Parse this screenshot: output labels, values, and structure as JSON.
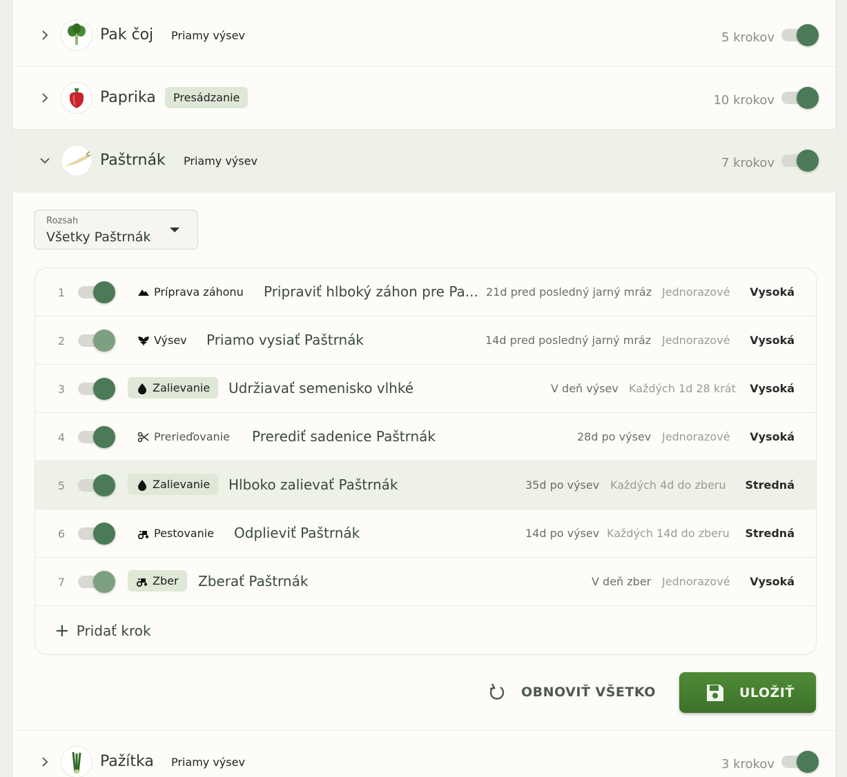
{
  "crops": [
    {
      "name": "Pak čoj",
      "method": "Priamy výsev",
      "steps": "5 krokov",
      "icon": "bok-choy-icon"
    },
    {
      "name": "Paprika",
      "method": "Presádzanie",
      "steps": "10 krokov",
      "icon": "pepper-icon"
    },
    {
      "name": "Paštrnák",
      "method": "Priamy výsev",
      "steps": "7 krokov",
      "icon": "parsnip-icon"
    },
    {
      "name": "Pažítka",
      "method": "Priamy výsev",
      "steps": "3 krokov",
      "icon": "chives-icon"
    }
  ],
  "scope": {
    "label": "Rozsah",
    "value": "Všetky Paštrnák"
  },
  "steps": [
    {
      "num": "1",
      "category": "Príprava záhonu",
      "title": "Pripraviť hlboký záhon pre Pa...",
      "when": "21d pred posledný jarný mráz",
      "repeat": "Jednorazové",
      "priority": "Vysoká",
      "icon": "mountain-icon"
    },
    {
      "num": "2",
      "category": "Výsev",
      "title": "Priamo vysiať Paštrnák",
      "when": "14d pred posledný jarný mráz",
      "repeat": "Jednorazové",
      "priority": "Vysoká",
      "icon": "sprout-icon"
    },
    {
      "num": "3",
      "category": "Zalievanie",
      "title": "Udržiavať semenisko vlhké",
      "when": "V deň výsev",
      "repeat": "Každých 1d 28 krát",
      "priority": "Vysoká",
      "icon": "water-drop-icon"
    },
    {
      "num": "4",
      "category": "Prerieďovanie",
      "title": "Prerediť sadenice Paštrnák",
      "when": "28d po výsev",
      "repeat": "Jednorazové",
      "priority": "Vysoká",
      "icon": "scissors-icon"
    },
    {
      "num": "5",
      "category": "Zalievanie",
      "title": "Hlboko zalievať Paštrnák",
      "when": "35d po výsev",
      "repeat": "Každých 4d do zberu",
      "priority": "Stredná",
      "icon": "water-drop-icon"
    },
    {
      "num": "6",
      "category": "Pestovanie",
      "title": "Odplieviť Paštrnák",
      "when": "14d po výsev",
      "repeat": "Každých 14d do zberu",
      "priority": "Stredná",
      "icon": "tractor-icon"
    },
    {
      "num": "7",
      "category": "Zber",
      "title": "Zberať Paštrnák",
      "when": "V deň zber",
      "repeat": "Jednorazové",
      "priority": "Vysoká",
      "icon": "tractor-icon"
    }
  ],
  "add_step": "Pridať krok",
  "actions": {
    "reset": "OBNOVIŤ VŠETKO",
    "save": "ULOŽIŤ"
  },
  "colors": {
    "accent": "#4b7a57",
    "save": "#447d2f",
    "pill": "#dfe8d6",
    "highlight": "#edf1e7"
  }
}
